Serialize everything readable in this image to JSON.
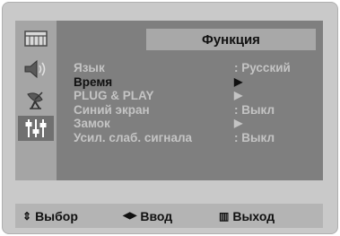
{
  "menu": {
    "title": "Функция",
    "items": [
      {
        "label": "Язык",
        "value": ": Русский"
      },
      {
        "label": "Время",
        "value": "▶"
      },
      {
        "label": "PLUG & PLAY",
        "value": "▶"
      },
      {
        "label": "Синий экран",
        "value": ": Выкл"
      },
      {
        "label": "Замок",
        "value": "▶"
      },
      {
        "label": "Усил. слаб. сигнала",
        "value": ": Выкл"
      }
    ],
    "selected_index": 1
  },
  "sidebar": {
    "icons": [
      "picture-icon",
      "sound-icon",
      "channel-antenna-icon",
      "function-settings-icon"
    ],
    "selected_icon": "function-settings-icon"
  },
  "footer": {
    "select_label": "Выбор",
    "enter_label": "Ввод",
    "exit_label": "Выход",
    "select_symbol": "⇕",
    "enter_symbol": "◀▶",
    "exit_symbol": "▥"
  },
  "colors": {
    "screen_bg": "#7f7f7f",
    "sidebar_bg": "#a5a5a5",
    "active_text": "#101010",
    "inactive_text": "#c4c4c4",
    "frame_bg": "#c9c9c9"
  }
}
